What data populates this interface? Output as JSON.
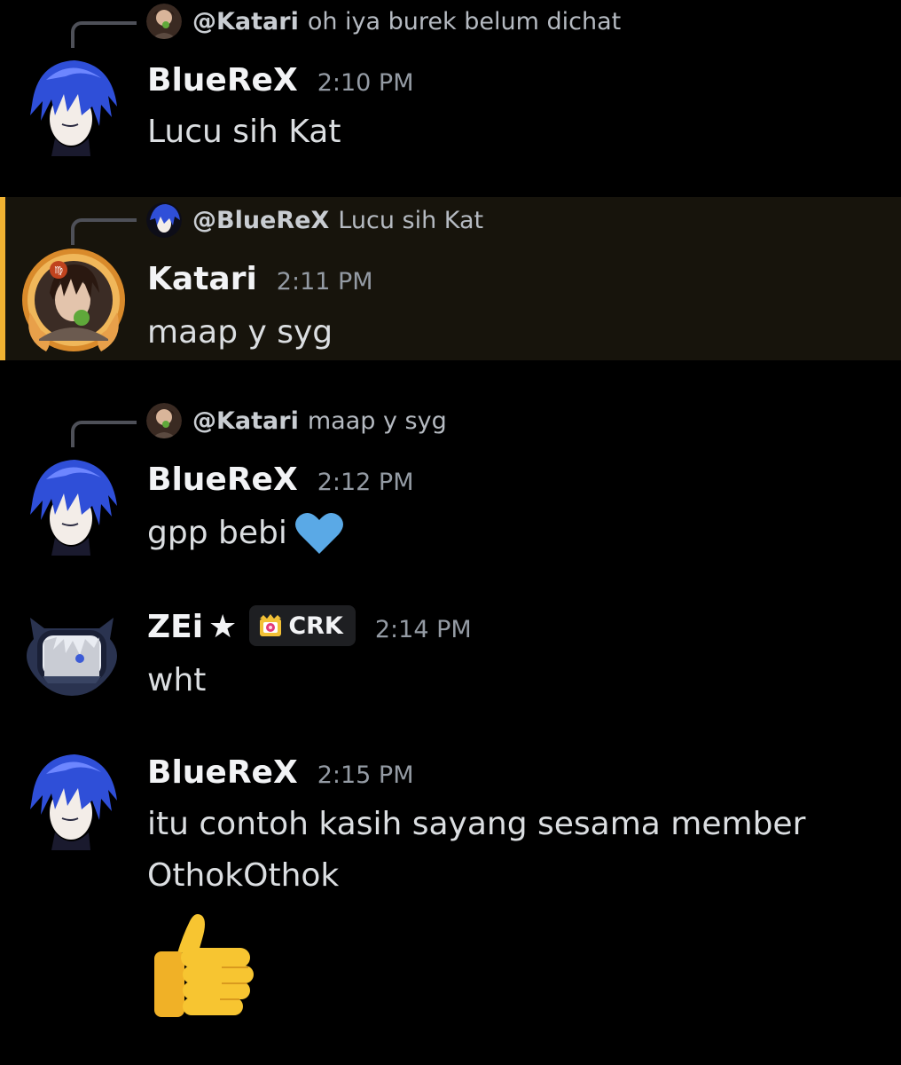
{
  "messages": [
    {
      "reply_to": {
        "name": "@Katari",
        "text": "oh iya burek belum dichat"
      },
      "author": "BlueReX",
      "time": "2:10 PM",
      "lines": [
        "Lucu sih Kat"
      ]
    },
    {
      "highlighted": true,
      "reply_to": {
        "name": "@BlueReX",
        "text": "Lucu sih Kat"
      },
      "author": "Katari",
      "time": "2:11 PM",
      "lines": [
        "maap y syg"
      ]
    },
    {
      "reply_to": {
        "name": "@Katari",
        "text": "maap y syg"
      },
      "author": "BlueReX",
      "time": "2:12 PM",
      "lines": [
        "gpp bebi"
      ],
      "emoji": "blue-heart"
    },
    {
      "author": "ZEi",
      "author_suffix": "★",
      "tag": "CRK",
      "time": "2:14 PM",
      "lines": [
        "wht"
      ]
    },
    {
      "author": "BlueReX",
      "time": "2:15 PM",
      "lines": [
        "itu contoh kasih sayang sesama member",
        "OthokOthok"
      ],
      "emoji": "thumbs-up"
    }
  ],
  "colors": {
    "background": "#000000",
    "highlight_bg": "#17140c",
    "highlight_bar": "#f0b232",
    "heart": "#5aa9e6",
    "thumb": "#f7c531"
  }
}
